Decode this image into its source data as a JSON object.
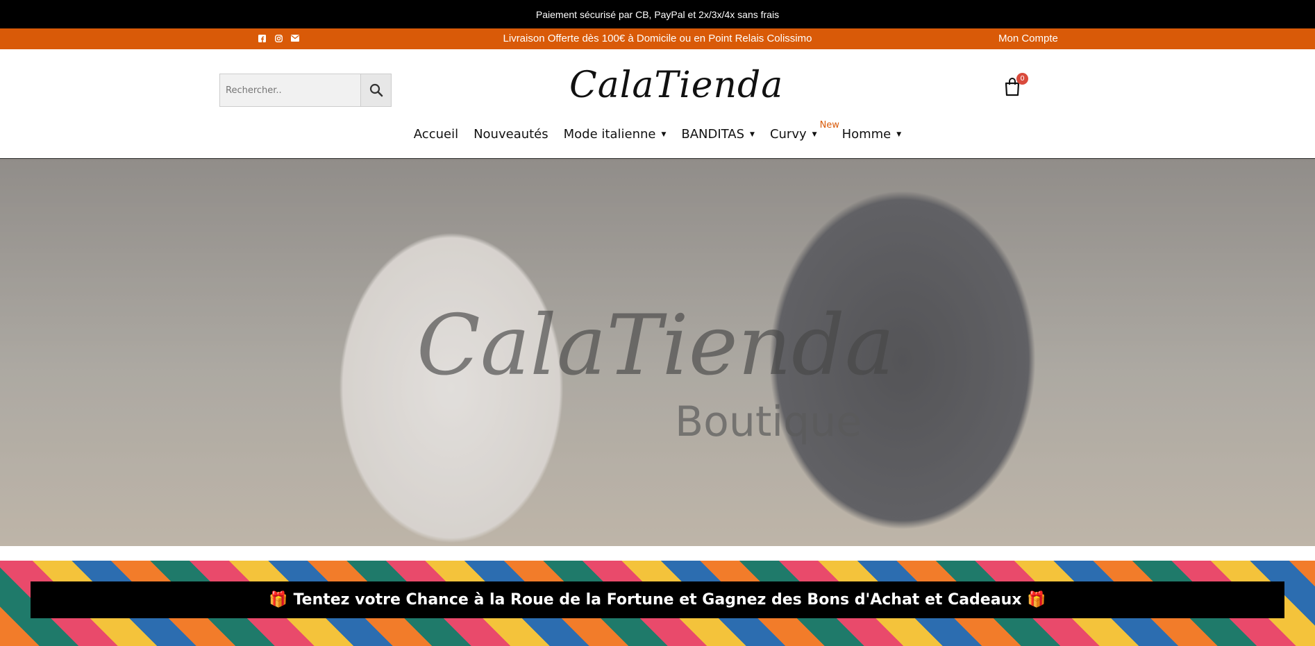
{
  "topbar": {
    "text": "Paiement sécurisé par CB, PayPal et 2x/3x/4x sans frais"
  },
  "orangebar": {
    "shipping": "Livraison Offerte dès 100€ à Domicile ou en Point Relais Colissimo",
    "account": "Mon Compte",
    "social": [
      "facebook-icon",
      "instagram-icon",
      "mail-icon"
    ]
  },
  "header": {
    "search_placeholder": "Rechercher..",
    "logo": "CalaTienda",
    "cart_count": "0"
  },
  "nav": {
    "items": [
      {
        "label": "Accueil",
        "dropdown": false
      },
      {
        "label": "Nouveautés",
        "dropdown": false
      },
      {
        "label": "Mode italienne",
        "dropdown": true
      },
      {
        "label": "BANDITAS",
        "dropdown": true
      },
      {
        "label": "Curvy",
        "dropdown": true
      },
      {
        "label": "Homme",
        "dropdown": true,
        "badge": "New"
      }
    ]
  },
  "hero": {
    "title": "CalaTienda",
    "subtitle": "Boutique"
  },
  "promo": {
    "text": "Tentez votre Chance à la Roue de la Fortune et Gagnez des Bons d'Achat et Cadeaux"
  },
  "colors": {
    "accent": "#d95a08",
    "topbar": "#000000",
    "badge": "#d94a3c"
  }
}
